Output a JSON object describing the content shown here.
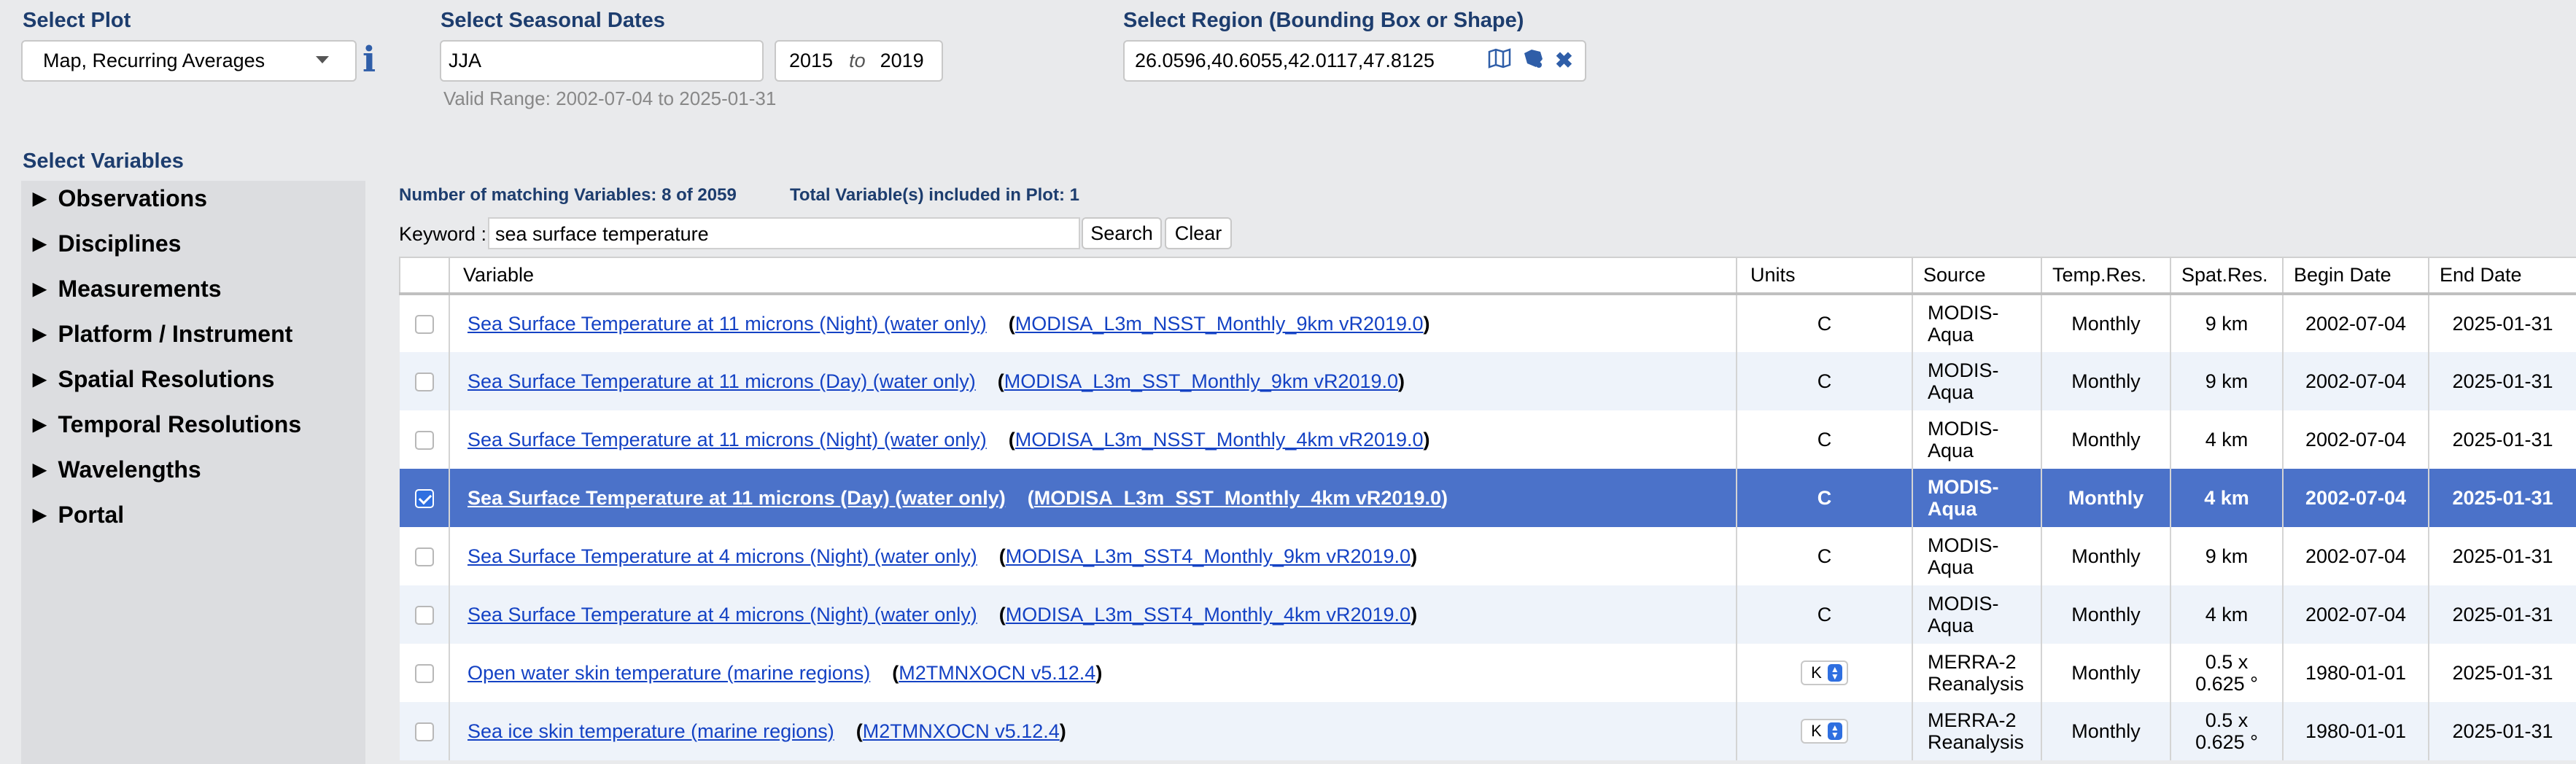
{
  "plot": {
    "label": "Select Plot",
    "value": "Map, Recurring Averages",
    "info_icon": "info-icon"
  },
  "dates": {
    "label": "Select Seasonal Dates",
    "season": "JJA",
    "year_start": "2015",
    "to": "to",
    "year_end": "2019",
    "valid_range": "Valid Range: 2002-07-04 to 2025-01-31"
  },
  "region": {
    "label": "Select Region (Bounding Box or Shape)",
    "value": "26.0596,40.6055,42.0117,47.8125",
    "icons": [
      "map-icon",
      "shape-icon",
      "close-icon"
    ]
  },
  "variables": {
    "label": "Select Variables",
    "tree": [
      "Observations",
      "Disciplines",
      "Measurements",
      "Platform / Instrument",
      "Spatial Resolutions",
      "Temporal Resolutions",
      "Wavelengths",
      "Portal"
    ]
  },
  "stats": {
    "matching": "Number of matching Variables: 8 of 2059",
    "included": "Total Variable(s) included in Plot: 1"
  },
  "search": {
    "label": "Keyword :",
    "value": "sea surface temperature",
    "search_btn": "Search",
    "clear_btn": "Clear"
  },
  "table": {
    "headers": [
      "",
      "Variable",
      "Units",
      "Source",
      "Temp.Res.",
      "Spat.Res.",
      "Begin Date",
      "End Date"
    ],
    "rows": [
      {
        "name": "Sea Surface Temperature at 11 microns (Night) (water only)",
        "product": "MODISA_L3m_NSST_Monthly_9km vR2019.0",
        "units": "C",
        "source": "MODIS-Aqua",
        "temp": "Monthly",
        "spat": "9 km",
        "begin": "2002-07-04",
        "end": "2025-01-31",
        "checked": false
      },
      {
        "name": "Sea Surface Temperature at 11 microns (Day) (water only)",
        "product": "MODISA_L3m_SST_Monthly_9km vR2019.0",
        "units": "C",
        "source": "MODIS-Aqua",
        "temp": "Monthly",
        "spat": "9 km",
        "begin": "2002-07-04",
        "end": "2025-01-31",
        "checked": false
      },
      {
        "name": "Sea Surface Temperature at 11 microns (Night) (water only)",
        "product": "MODISA_L3m_NSST_Monthly_4km vR2019.0",
        "units": "C",
        "source": "MODIS-Aqua",
        "temp": "Monthly",
        "spat": "4 km",
        "begin": "2002-07-04",
        "end": "2025-01-31",
        "checked": false
      },
      {
        "name": "Sea Surface Temperature at 11 microns (Day) (water only)",
        "product": "MODISA_L3m_SST_Monthly_4km vR2019.0",
        "units": "C",
        "source": "MODIS-Aqua",
        "temp": "Monthly",
        "spat": "4 km",
        "begin": "2002-07-04",
        "end": "2025-01-31",
        "checked": true
      },
      {
        "name": "Sea Surface Temperature at 4 microns (Night) (water only)",
        "product": "MODISA_L3m_SST4_Monthly_9km vR2019.0",
        "units": "C",
        "source": "MODIS-Aqua",
        "temp": "Monthly",
        "spat": "9 km",
        "begin": "2002-07-04",
        "end": "2025-01-31",
        "checked": false
      },
      {
        "name": "Sea Surface Temperature at 4 microns (Night) (water only)",
        "product": "MODISA_L3m_SST4_Monthly_4km vR2019.0",
        "units": "C",
        "source": "MODIS-Aqua",
        "temp": "Monthly",
        "spat": "4 km",
        "begin": "2002-07-04",
        "end": "2025-01-31",
        "checked": false
      },
      {
        "name": "Open water skin temperature (marine regions)",
        "product": "M2TMNXOCN v5.12.4",
        "units": "K",
        "source": "MERRA-2 Reanalysis",
        "temp": "Monthly",
        "spat": "0.5 x 0.625 °",
        "begin": "1980-01-01",
        "end": "2025-01-31",
        "checked": false
      },
      {
        "name": "Sea ice skin temperature (marine regions)",
        "product": "M2TMNXOCN v5.12.4",
        "units": "K",
        "source": "MERRA-2 Reanalysis",
        "temp": "Monthly",
        "spat": "0.5 x 0.625 °",
        "begin": "1980-01-01",
        "end": "2025-01-31",
        "checked": false
      }
    ]
  }
}
